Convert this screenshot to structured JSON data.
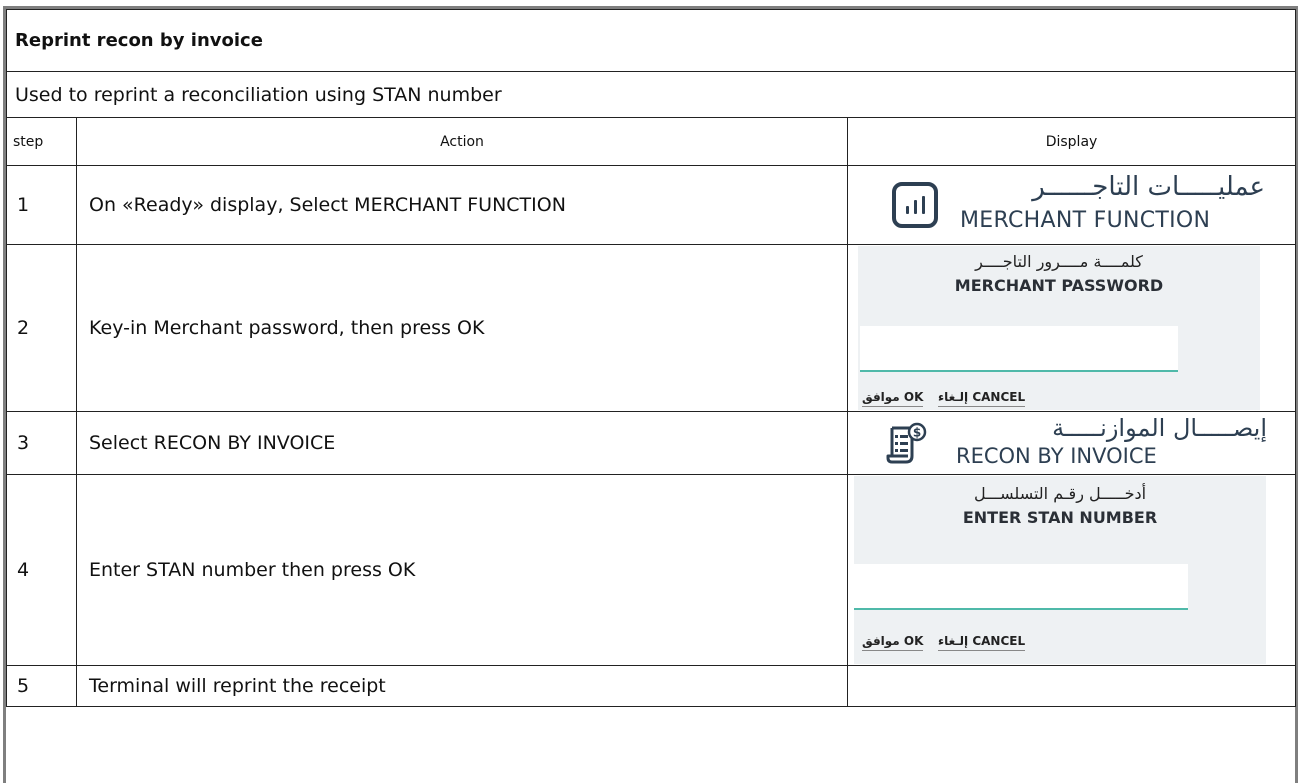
{
  "title": "Reprint recon by invoice",
  "description": "Used to reprint a reconciliation using STAN number",
  "headers": {
    "step": "step",
    "action": "Action",
    "display": "Display"
  },
  "steps": [
    {
      "num": "1",
      "action": "On «Ready» display, Select MERCHANT FUNCTION",
      "display": {
        "icon": "bar-chart-icon",
        "arabic": "عمليـــــات التاجــــــر",
        "english": "MERCHANT FUNCTION"
      }
    },
    {
      "num": "2",
      "action": "Key-in Merchant password, then press OK",
      "display": {
        "arabic": "كلمــــة مــــرور التاجــــر",
        "english": "MERCHANT PASSWORD",
        "ok_label": "موافق OK",
        "cancel_label": "إلـغاء CANCEL"
      }
    },
    {
      "num": "3",
      "action": "Select RECON BY INVOICE",
      "display": {
        "icon": "receipt-dollar-icon",
        "arabic": "إيصـــــال الموازنـــــة",
        "english": "RECON BY INVOICE"
      }
    },
    {
      "num": "4",
      "action": "Enter STAN number then press OK",
      "display": {
        "arabic": "أدخـــــل رقـم التسلســـل",
        "english": "ENTER STAN NUMBER",
        "ok_label": "موافق OK",
        "cancel_label": "إلـغاء CANCEL"
      }
    },
    {
      "num": "5",
      "action": "Terminal will reprint the receipt",
      "display": null
    }
  ],
  "colors": {
    "icon": "#2d3f52",
    "input_underline": "#4fb9a9",
    "panel_bg": "#eef1f3",
    "frame": "#7f7f7f"
  }
}
